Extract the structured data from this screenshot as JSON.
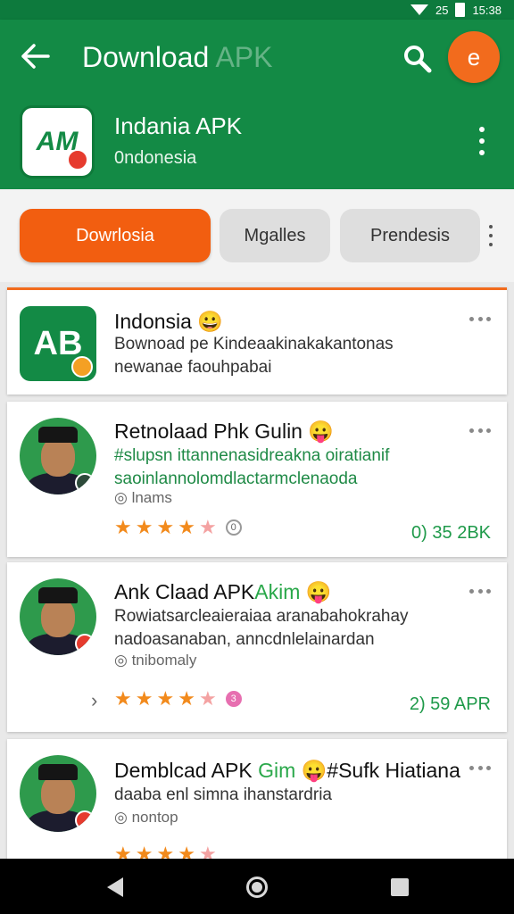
{
  "status_bar": {
    "text": "25",
    "time": "15:38"
  },
  "toolbar": {
    "title_main": "Download",
    "title_faded": "APK",
    "avatar_glyph": "e"
  },
  "app": {
    "name": "Indania APK",
    "country": "0ndonesia",
    "logo_text": "AM"
  },
  "chips": [
    {
      "label": "Dowrlosia",
      "active": true
    },
    {
      "label": "Mgalles",
      "active": false
    },
    {
      "label": "Prendesis",
      "active": false
    }
  ],
  "cards": [
    {
      "logo_text": "AB",
      "title": "Indonsia",
      "emoji": "😀",
      "desc_lines": [
        "Bownoad pe Kindeaakinakakantonas",
        "newanae faouhpabai"
      ]
    },
    {
      "title": "Retnolaad Phk Gulin",
      "emoji": "😛",
      "desc_lines": [
        "#slupsn ittannenasidreakna oiratianif",
        "saoinlannolomdlactarmclenaoda"
      ],
      "meta": "lnams",
      "stars": 4,
      "rating_badge": "0",
      "size": "0) 35 2BK"
    },
    {
      "title": "Ank Claad APK",
      "title_green": "Akim",
      "emoji": "😛",
      "desc_lines": [
        "Rowiatsarcleaieraiaa aranabahokrahay",
        "nadoasanaban, anncdnlelainardan"
      ],
      "meta": "tnibomaly",
      "stars": 4,
      "rating_badge": "3",
      "size": "2) 59 APR"
    },
    {
      "title": "Demblcad APK",
      "title_green": "Gim",
      "emoji": "😛",
      "title_suffix": "#Sufk Hiatiana",
      "desc_lines": [
        "daaba enl simna ihanstardria"
      ],
      "meta": "nontop"
    }
  ],
  "colors": {
    "primary": "#138a45",
    "accent": "#f25e10",
    "size_text": "#1f9a4a"
  }
}
